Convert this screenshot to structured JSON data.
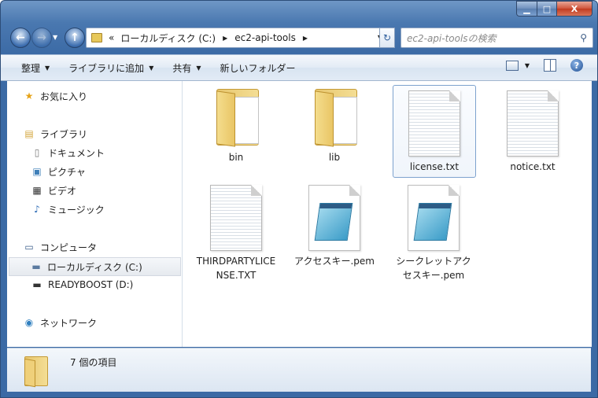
{
  "window": {
    "minimize": "▁",
    "maximize": "□",
    "close": "X"
  },
  "nav": {
    "back_icon": "arrow-left",
    "forward_icon": "arrow-right",
    "up_icon": "arrow-up",
    "address_prefix": "«",
    "address": [
      "ローカルディスク (C:)",
      "ec2-api-tools"
    ],
    "search_placeholder": "ec2-api-toolsの検索"
  },
  "toolbar": {
    "organize": "整理",
    "add_library": "ライブラリに追加",
    "share": "共有",
    "new_folder": "新しいフォルダー",
    "help": "?"
  },
  "sidebar": {
    "favorites": "お気に入り",
    "libraries": "ライブラリ",
    "documents": "ドキュメント",
    "pictures": "ピクチャ",
    "videos": "ビデオ",
    "music": "ミュージック",
    "computer": "コンピュータ",
    "local_disk": "ローカルディスク (C:)",
    "readyboost": "READYBOOST (D:)",
    "network": "ネットワーク"
  },
  "files": [
    {
      "name": "bin",
      "type": "folder"
    },
    {
      "name": "lib",
      "type": "folder"
    },
    {
      "name": "license.txt",
      "type": "text",
      "selected": true
    },
    {
      "name": "notice.txt",
      "type": "text"
    },
    {
      "name": "THIRDPARTYLICENSE.TXT",
      "type": "text"
    },
    {
      "name": "アクセスキー.pem",
      "type": "pem"
    },
    {
      "name": "シークレットアクセスキー.pem",
      "type": "pem"
    }
  ],
  "status": {
    "item_count": "7 個の項目"
  },
  "colors": {
    "frame": "#4a78b0",
    "accent": "#7da2ce",
    "folder": "#e7c66d"
  }
}
